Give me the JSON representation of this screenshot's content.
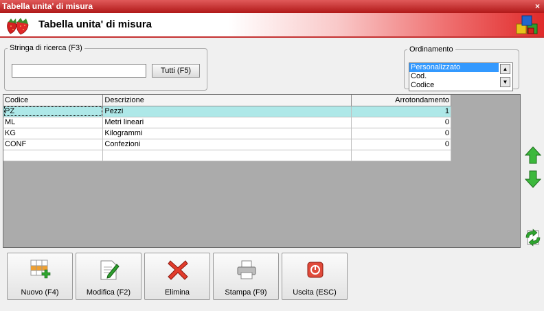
{
  "window": {
    "title": "Tabella unita' di misura",
    "close_glyph": "×"
  },
  "header": {
    "title": "Tabella unita' di misura"
  },
  "search": {
    "legend": "Stringa di ricerca (F3)",
    "value": "",
    "all_button": "Tutti (F5)"
  },
  "ordering": {
    "legend": "Ordinamento",
    "options": [
      "Personalizzato",
      "Cod.",
      "Codice"
    ],
    "selected": "Personalizzato"
  },
  "table": {
    "columns": [
      "Codice",
      "Descrizione",
      "Arrotondamento"
    ],
    "rows": [
      {
        "code": "PZ",
        "description": "Pezzi",
        "rounding": "1"
      },
      {
        "code": "ML",
        "description": "Metri lineari",
        "rounding": "0"
      },
      {
        "code": "KG",
        "description": "Kilogrammi",
        "rounding": "0"
      },
      {
        "code": "CONF",
        "description": "Confezioni",
        "rounding": "0"
      }
    ],
    "selected_row": 0
  },
  "buttons": {
    "new": "Nuovo (F4)",
    "edit": "Modifica (F2)",
    "delete": "Elimina",
    "print": "Stampa (F9)",
    "exit": "Uscita (ESC)"
  },
  "icons": {
    "logo": "strawberry-icon",
    "app": "cubes-icon",
    "move_up": "arrow-up-icon",
    "move_down": "arrow-down-icon",
    "refresh": "refresh-icon"
  },
  "colors": {
    "accent": "#c62828",
    "selected_row": "#aee8e8",
    "selected_option": "#3399ff"
  }
}
